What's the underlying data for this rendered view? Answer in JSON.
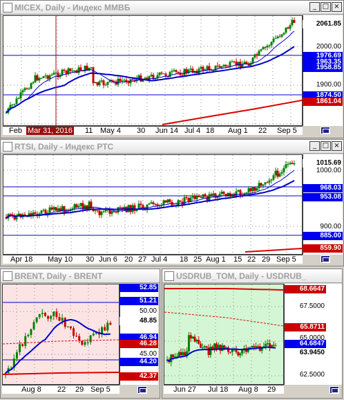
{
  "windows": [
    {
      "id": "micex",
      "title": "MICEX, Daily - Индекс ММВБ",
      "buttons": [
        "_",
        "□",
        "×"
      ],
      "x_ticks": [
        "Feb",
        "Mar 31, 2016",
        "11",
        "May 4",
        "30",
        "Jun 14",
        "Jul 4",
        "18",
        "Aug 1",
        "22",
        "Sep 5"
      ],
      "y_ticks": [
        "2000.00",
        "1900.00"
      ],
      "price_labels": {
        "last": "2061.85",
        "l1": "1976.69",
        "l2": "1963.35",
        "l3": "1958.85",
        "l4": "1874.50",
        "l5": "1861.04"
      }
    },
    {
      "id": "rtsi",
      "title": "RTSI, Daily - Индекс РТС",
      "buttons": [
        "_",
        "□",
        "×"
      ],
      "x_ticks": [
        "Apr 18",
        "May 10",
        "30",
        "Jun 6",
        "20",
        "27",
        "Jul 4",
        "18",
        "25",
        "Aug 1",
        "15",
        "22",
        "29",
        "Sep 5"
      ],
      "y_ticks": [
        "1000.00",
        "900.00"
      ],
      "price_labels": {
        "last": "1015.69",
        "l1": "968.03",
        "l2": "953.08",
        "l3": "885.00",
        "l4": "859.90"
      }
    },
    {
      "id": "brent",
      "title": "BRENT, Daily - BRENT",
      "buttons": [
        "_",
        "□",
        "×"
      ],
      "x_ticks": [
        "Aug 8",
        "22",
        "29",
        "Sep 5"
      ],
      "y_ticks": [
        "50.00",
        "45.00"
      ],
      "price_labels": {
        "l0": "52.85",
        "l1": "51.21",
        "last": "48.85",
        "l2": "46.94",
        "l3": "46.28",
        "l4": "44.20",
        "l5": "42.37"
      }
    },
    {
      "id": "usdrub",
      "title": "USDRUB_TOM, Daily - USDRUB_",
      "buttons": [
        "_",
        "□",
        "×"
      ],
      "x_ticks": [
        "Jun 27",
        "Jul 18",
        "Aug 8",
        "29"
      ],
      "y_ticks": [
        "67.5000",
        "65.0000",
        "62.5000"
      ],
      "price_labels": {
        "l0": "68.6647",
        "l1": "65.8711",
        "l2": "64.6847",
        "last": "63.9450"
      }
    }
  ],
  "colors": {
    "candle_up": "#008000",
    "candle_down": "#cc0000",
    "ma_blue": "#0000cc",
    "ma_red": "#dd0000",
    "brent_bg": "#fde4e4",
    "usdrub_bg": "#d4f6d4"
  }
}
